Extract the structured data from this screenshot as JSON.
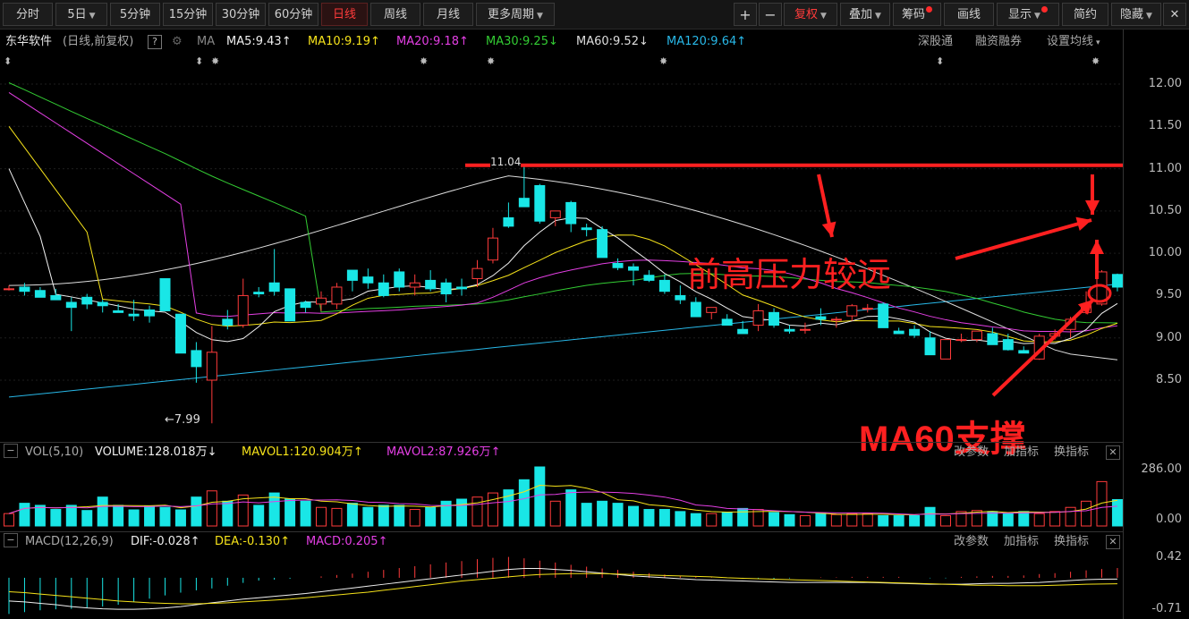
{
  "toolbar": {
    "left": [
      "分时",
      "5日",
      "5分钟",
      "15分钟",
      "30分钟",
      "60分钟",
      "日线",
      "周线",
      "月线",
      "更多周期"
    ],
    "active": "日线",
    "plus": "+",
    "minus": "−",
    "fuquan": "复权",
    "overlay": "叠加",
    "chips": "筹码",
    "draw": "画线",
    "display": "显示",
    "simple": "简约",
    "hide": "隐藏",
    "min": "−",
    "restore": "❐",
    "close": "✕"
  },
  "stock": {
    "name": "东华软件",
    "mode": "(日线,前复权)",
    "question": "?",
    "ma_label": "MA"
  },
  "ma": [
    {
      "label": "MA5:9.43",
      "arrow": "↑",
      "color": "#f0f0f0"
    },
    {
      "label": "MA10:9.19",
      "arrow": "↑",
      "color": "#f5e21a"
    },
    {
      "label": "MA20:9.18",
      "arrow": "↑",
      "color": "#e43fe4"
    },
    {
      "label": "MA30:9.25",
      "arrow": "↓",
      "color": "#33cc33"
    },
    {
      "label": "MA60:9.52",
      "arrow": "↓",
      "color": "#dddddd"
    },
    {
      "label": "MA120:9.64",
      "arrow": "↑",
      "color": "#28b8e8"
    }
  ],
  "right_links": {
    "sz": "深股通",
    "margin": "融资融券",
    "set_ma": "设置均线"
  },
  "price_axis": [
    "12.00",
    "11.50",
    "11.00",
    "10.50",
    "10.00",
    "9.50",
    "9.00",
    "8.50"
  ],
  "price_marks": {
    "high": "11.04",
    "low": "←7.99"
  },
  "annotations": {
    "pressure": "前高压力较远",
    "support": "MA60支撑"
  },
  "volume": {
    "title": "VOL(5,10)",
    "volume": "VOLUME:128.018万",
    "volume_arrow": "↓",
    "mavol1": "MAVOL1:120.904万",
    "mavol1_arrow": "↑",
    "mavol2": "MAVOL2:87.926万",
    "mavol2_arrow": "↑",
    "axis_top": "286.00",
    "axis_bottom": "0.00"
  },
  "macd": {
    "title": "MACD(12,26,9)",
    "dif": "DIF:-0.028",
    "dif_arrow": "↑",
    "dea": "DEA:-0.130",
    "dea_arrow": "↑",
    "macd": "MACD:0.205",
    "macd_arrow": "↑",
    "axis_top": "0.42",
    "axis_bottom": "-0.71"
  },
  "panel_links": {
    "params": "改参数",
    "add": "加指标",
    "swap": "换指标",
    "close": "✕",
    "minus": "−"
  },
  "colors": {
    "up": "#ff3b3b",
    "down": "#19e6e6",
    "ma5": "#f0f0f0",
    "ma10": "#f5e21a",
    "ma20": "#e43fe4",
    "ma30": "#33cc33",
    "ma60": "#dddddd",
    "ma120": "#28b8e8",
    "annotation": "#ff2020"
  },
  "chart_data": {
    "type": "candlestick",
    "price_range": [
      8.2,
      12.3
    ],
    "candles": [
      [
        9.58,
        9.62,
        9.56,
        9.58
      ],
      [
        9.6,
        9.65,
        9.5,
        9.55
      ],
      [
        9.56,
        9.6,
        9.48,
        9.48
      ],
      [
        9.5,
        9.58,
        9.45,
        9.45
      ],
      [
        9.42,
        9.48,
        9.08,
        9.36
      ],
      [
        9.48,
        9.52,
        9.34,
        9.4
      ],
      [
        9.42,
        9.45,
        9.3,
        9.38
      ],
      [
        9.32,
        9.4,
        9.3,
        9.3
      ],
      [
        9.28,
        9.45,
        9.2,
        9.26
      ],
      [
        9.33,
        9.38,
        9.18,
        9.26
      ],
      [
        9.7,
        9.7,
        9.32,
        9.32
      ],
      [
        9.28,
        9.28,
        8.82,
        8.82
      ],
      [
        8.85,
        8.95,
        8.47,
        8.66
      ],
      [
        8.5,
        9.14,
        7.99,
        8.83
      ],
      [
        9.22,
        9.33,
        9.1,
        9.15
      ],
      [
        9.15,
        9.7,
        9.12,
        9.5
      ],
      [
        9.54,
        9.6,
        9.48,
        9.52
      ],
      [
        9.65,
        10.05,
        9.5,
        9.55
      ],
      [
        9.58,
        9.58,
        9.24,
        9.2
      ],
      [
        9.42,
        9.44,
        9.3,
        9.36
      ],
      [
        9.4,
        9.55,
        9.32,
        9.47
      ],
      [
        9.4,
        9.65,
        9.34,
        9.6
      ],
      [
        9.8,
        9.8,
        9.55,
        9.68
      ],
      [
        9.72,
        9.82,
        9.58,
        9.65
      ],
      [
        9.65,
        9.75,
        9.48,
        9.5
      ],
      [
        9.78,
        9.82,
        9.55,
        9.6
      ],
      [
        9.6,
        9.75,
        9.5,
        9.65
      ],
      [
        9.68,
        9.8,
        9.55,
        9.58
      ],
      [
        9.65,
        9.7,
        9.42,
        9.52
      ],
      [
        9.6,
        9.7,
        9.5,
        9.58
      ],
      [
        9.7,
        9.92,
        9.6,
        9.82
      ],
      [
        9.92,
        10.3,
        9.88,
        10.18
      ],
      [
        10.42,
        10.6,
        10.3,
        10.32
      ],
      [
        10.65,
        11.04,
        10.55,
        10.55
      ],
      [
        10.8,
        10.82,
        10.35,
        10.38
      ],
      [
        10.42,
        10.5,
        10.32,
        10.5
      ],
      [
        10.6,
        10.62,
        10.25,
        10.35
      ],
      [
        10.3,
        10.35,
        10.2,
        10.28
      ],
      [
        10.28,
        10.32,
        9.95,
        9.95
      ],
      [
        9.88,
        9.94,
        9.8,
        9.83
      ],
      [
        9.84,
        9.88,
        9.62,
        9.8
      ],
      [
        9.74,
        9.8,
        9.66,
        9.68
      ],
      [
        9.68,
        9.75,
        9.52,
        9.55
      ],
      [
        9.5,
        9.62,
        9.4,
        9.45
      ],
      [
        9.42,
        9.48,
        9.25,
        9.25
      ],
      [
        9.3,
        9.36,
        9.22,
        9.36
      ],
      [
        9.22,
        9.28,
        9.15,
        9.15
      ],
      [
        9.1,
        9.2,
        9.05,
        9.05
      ],
      [
        9.15,
        9.4,
        9.08,
        9.32
      ],
      [
        9.3,
        9.35,
        9.12,
        9.15
      ],
      [
        9.1,
        9.15,
        9.05,
        9.08
      ],
      [
        9.1,
        9.18,
        9.05,
        9.1
      ],
      [
        9.25,
        9.35,
        9.15,
        9.22
      ],
      [
        9.22,
        9.25,
        9.12,
        9.22
      ],
      [
        9.26,
        9.4,
        9.2,
        9.38
      ],
      [
        9.35,
        9.4,
        9.3,
        9.35
      ],
      [
        9.4,
        9.42,
        9.12,
        9.12
      ],
      [
        9.08,
        9.12,
        9.05,
        9.05
      ],
      [
        9.1,
        9.15,
        9.0,
        9.03
      ],
      [
        9.0,
        9.08,
        8.8,
        8.8
      ],
      [
        8.75,
        8.98,
        8.75,
        8.98
      ],
      [
        8.98,
        9.05,
        8.95,
        8.98
      ],
      [
        8.98,
        9.08,
        8.95,
        9.08
      ],
      [
        9.05,
        9.12,
        8.92,
        8.92
      ],
      [
        8.98,
        9.05,
        8.85,
        8.86
      ],
      [
        8.85,
        8.9,
        8.82,
        8.82
      ],
      [
        8.75,
        9.05,
        8.74,
        9.02
      ],
      [
        9.02,
        9.1,
        8.98,
        9.05
      ],
      [
        9.1,
        9.25,
        9.0,
        9.22
      ],
      [
        9.3,
        9.55,
        9.28,
        9.38
      ],
      [
        9.4,
        9.8,
        9.38,
        9.78
      ],
      [
        9.75,
        9.76,
        9.55,
        9.6
      ]
    ],
    "volume_range": [
      0,
      286
    ],
    "volume": [
      60,
      110,
      100,
      80,
      100,
      75,
      140,
      100,
      78,
      96,
      90,
      78,
      140,
      170,
      120,
      150,
      100,
      160,
      130,
      120,
      90,
      85,
      110,
      90,
      100,
      100,
      80,
      90,
      120,
      130,
      140,
      160,
      175,
      224,
      286,
      120,
      175,
      110,
      120,
      110,
      95,
      80,
      80,
      70,
      60,
      60,
      65,
      85,
      80,
      65,
      55,
      50,
      60,
      55,
      60,
      60,
      50,
      50,
      50,
      90,
      50,
      70,
      75,
      70,
      60,
      70,
      60,
      70,
      90,
      120,
      215,
      128
    ],
    "macd_range": [
      -0.71,
      0.42
    ],
    "macd_bars": [
      -0.78,
      -0.74,
      -0.7,
      -0.68,
      -0.67,
      -0.65,
      -0.62,
      -0.58,
      -0.52,
      -0.45,
      -0.38,
      -0.32,
      -0.27,
      -0.23,
      -0.17,
      -0.11,
      -0.06,
      -0.04,
      -0.02,
      0.0,
      0.03,
      0.06,
      0.09,
      0.13,
      0.17,
      0.21,
      0.25,
      0.29,
      0.33,
      0.36,
      0.4,
      0.43,
      0.45,
      0.42,
      0.37,
      0.33,
      0.28,
      0.24,
      0.2,
      0.17,
      0.13,
      0.1,
      0.07,
      0.04,
      0.02,
      0.01,
      0.0,
      -0.01,
      -0.02,
      -0.02,
      -0.01,
      0.0,
      0.01,
      0.01,
      0.02,
      0.02,
      0.02,
      0.02,
      0.0,
      -0.01,
      -0.01,
      0.02,
      0.03,
      0.04,
      0.04,
      0.05,
      0.08,
      0.1,
      0.13,
      0.16,
      0.19,
      0.21
    ],
    "dif": [
      -0.5,
      -0.52,
      -0.55,
      -0.58,
      -0.62,
      -0.65,
      -0.67,
      -0.68,
      -0.68,
      -0.67,
      -0.65,
      -0.62,
      -0.58,
      -0.54,
      -0.5,
      -0.46,
      -0.43,
      -0.4,
      -0.37,
      -0.34,
      -0.3,
      -0.26,
      -0.22,
      -0.18,
      -0.14,
      -0.1,
      -0.06,
      -0.02,
      0.02,
      0.06,
      0.1,
      0.14,
      0.18,
      0.2,
      0.2,
      0.18,
      0.16,
      0.13,
      0.1,
      0.07,
      0.04,
      0.02,
      0.0,
      -0.02,
      -0.04,
      -0.05,
      -0.06,
      -0.07,
      -0.08,
      -0.09,
      -0.1,
      -0.1,
      -0.1,
      -0.1,
      -0.1,
      -0.1,
      -0.11,
      -0.12,
      -0.13,
      -0.14,
      -0.14,
      -0.14,
      -0.13,
      -0.12,
      -0.12,
      -0.11,
      -0.1,
      -0.08,
      -0.06,
      -0.04,
      -0.03,
      -0.028
    ],
    "dea": [
      -0.3,
      -0.32,
      -0.35,
      -0.38,
      -0.41,
      -0.44,
      -0.47,
      -0.5,
      -0.52,
      -0.54,
      -0.55,
      -0.56,
      -0.56,
      -0.55,
      -0.54,
      -0.52,
      -0.5,
      -0.48,
      -0.46,
      -0.43,
      -0.4,
      -0.37,
      -0.34,
      -0.31,
      -0.27,
      -0.23,
      -0.19,
      -0.15,
      -0.11,
      -0.07,
      -0.04,
      -0.01,
      0.02,
      0.05,
      0.07,
      0.08,
      0.09,
      0.09,
      0.09,
      0.08,
      0.07,
      0.06,
      0.05,
      0.04,
      0.03,
      0.02,
      0.0,
      -0.01,
      -0.02,
      -0.03,
      -0.04,
      -0.05,
      -0.06,
      -0.07,
      -0.08,
      -0.09,
      -0.1,
      -0.11,
      -0.12,
      -0.13,
      -0.14,
      -0.15,
      -0.16,
      -0.16,
      -0.17,
      -0.17,
      -0.17,
      -0.16,
      -0.15,
      -0.14,
      -0.135,
      -0.13
    ]
  }
}
